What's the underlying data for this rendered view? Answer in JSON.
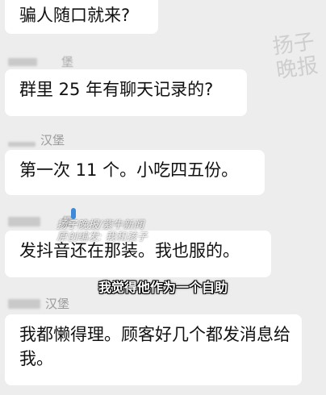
{
  "messages": [
    {
      "sender": "",
      "text": "骗人随口就来?"
    },
    {
      "sender": "堡",
      "text": "群里 25 年有聊天记录的?"
    },
    {
      "sender": "汉堡",
      "text": "第一次 11 个。小吃四五份。"
    },
    {
      "sender": "堡",
      "text": "发抖音还在那装。我也服的。"
    },
    {
      "sender": "汉堡",
      "text": "我都懒得理。顾客好几个都发消息给我。"
    }
  ],
  "watermark": {
    "corner_line1": "扬子",
    "corner_line2": "晚报",
    "overlay_line1": "扬子晚报/紫牛新闻",
    "overlay_line2": "原创编发: 我和孩子"
  },
  "subtitle": "我觉得他作为一个自助"
}
